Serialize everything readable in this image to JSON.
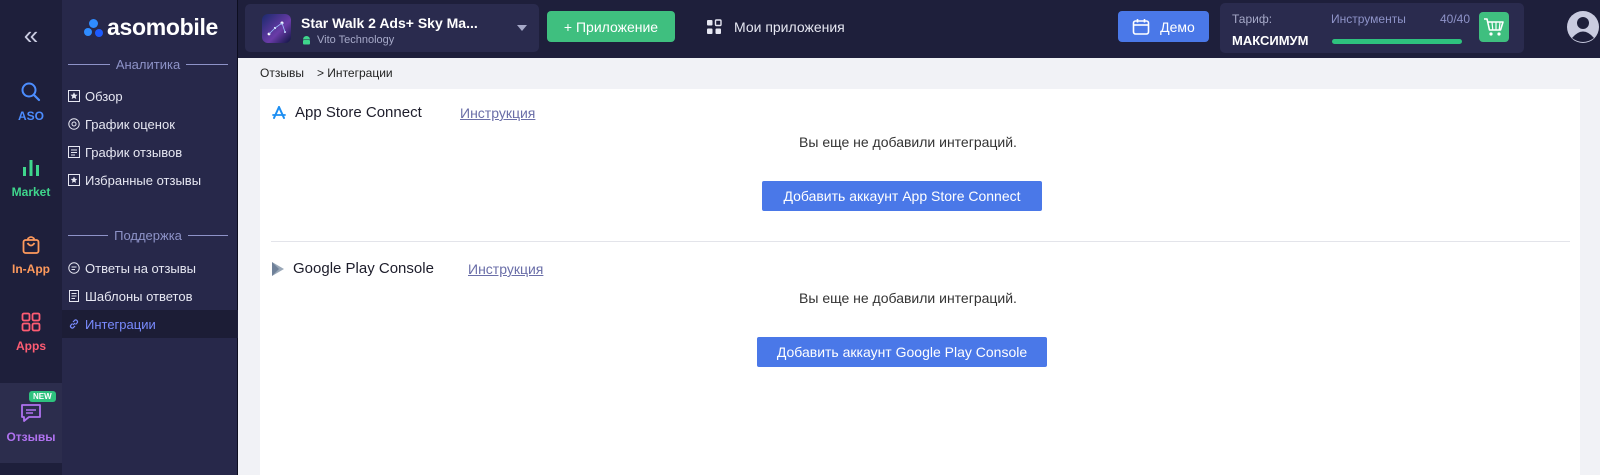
{
  "rail": {
    "collapse_icon": "double-chevron-left-icon",
    "items": [
      {
        "label": "ASO",
        "icon": "search-icon",
        "color": "#4c8dff"
      },
      {
        "label": "Market",
        "icon": "bar-chart-icon",
        "color": "#3fd68c"
      },
      {
        "label": "In-App",
        "icon": "shopping-bag-icon",
        "color": "#ff9a5c"
      },
      {
        "label": "Apps",
        "icon": "grid-icon",
        "color": "#ff5c73"
      },
      {
        "label": "Отзывы",
        "icon": "chat-icon",
        "color": "#b072f0",
        "badge": "NEW"
      }
    ]
  },
  "brand": {
    "logo_text": "asomobile"
  },
  "sidebar": {
    "analytics_header": "Аналитика",
    "analytics_items": [
      {
        "label": "Обзор",
        "icon": "star-box-icon"
      },
      {
        "label": "График оценок",
        "icon": "rating-icon"
      },
      {
        "label": "График отзывов",
        "icon": "reviews-chart-icon"
      },
      {
        "label": "Избранные отзывы",
        "icon": "favorite-box-icon"
      }
    ],
    "support_header": "Поддержка",
    "support_items": [
      {
        "label": "Ответы на отзывы",
        "icon": "replies-icon"
      },
      {
        "label": "Шаблоны ответов",
        "icon": "template-icon"
      },
      {
        "label": "Интеграции",
        "icon": "link-icon",
        "active": true
      }
    ]
  },
  "topbar": {
    "app_name": "Star Walk 2 Ads+ Sky Ma...",
    "app_developer": "Vito Technology",
    "add_app_label": "+ Приложение",
    "my_apps_label": "Мои приложения",
    "demo_label": "Демо",
    "tariff_label": "Тариф:",
    "tariff_value": "МАКСИМУМ",
    "tools_label": "Инструменты",
    "tools_count": "40/40",
    "tools_fraction": 1.0
  },
  "breadcrumb": {
    "parent": "Отзывы",
    "current": "> Интеграции"
  },
  "integrations": [
    {
      "title": "App Store Connect",
      "instruction_label": "Инструкция",
      "empty_text": "Вы еще не добавили интеграций.",
      "button_label": "Добавить аккаунт App Store Connect",
      "icon": "app-store-icon"
    },
    {
      "title": "Google Play Console",
      "instruction_label": "Инструкция",
      "empty_text": "Вы еще не добавили интеграций.",
      "button_label": "Добавить аккаунт Google Play Console",
      "icon": "google-play-icon"
    }
  ],
  "colors": {
    "accent": "#4a78e8",
    "success": "#3fbf7f",
    "nav_bg": "#1e1f3b"
  }
}
